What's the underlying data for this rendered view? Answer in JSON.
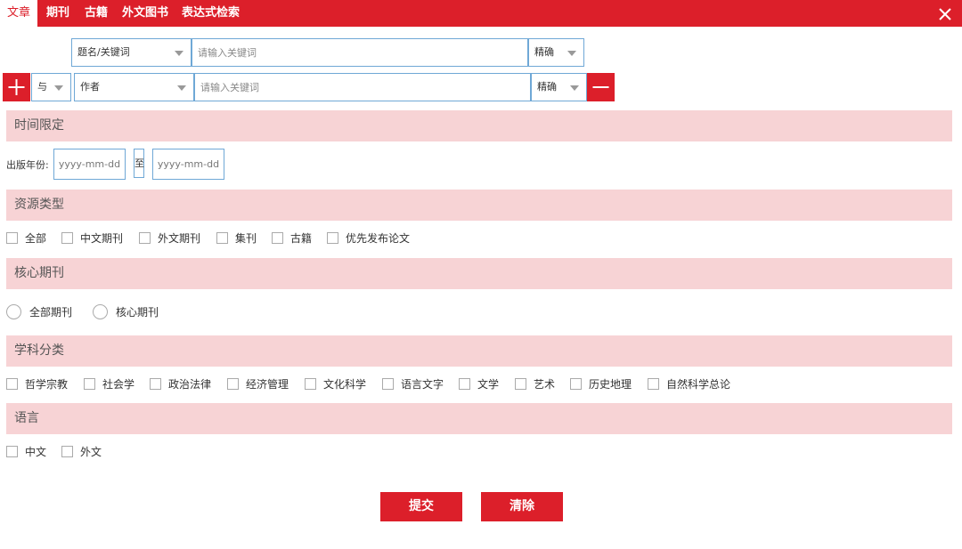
{
  "tabs": [
    {
      "label": "文章",
      "active": true
    },
    {
      "label": "期刊",
      "active": false
    },
    {
      "label": "古籍",
      "active": false
    },
    {
      "label": "外文图书",
      "active": false
    },
    {
      "label": "表达式检索",
      "active": false
    }
  ],
  "search": {
    "row1": {
      "field": "题名/关键词",
      "placeholder": "请输入关键词",
      "match": "精确"
    },
    "row2": {
      "logic": "与",
      "field": "作者",
      "placeholder": "请输入关键词",
      "match": "精确"
    }
  },
  "time_section": {
    "title": "时间限定",
    "label": "出版年份:",
    "from_placeholder": "yyyy-mm-dd",
    "to_text": "至",
    "to_placeholder": "yyyy-mm-dd"
  },
  "resource_section": {
    "title": "资源类型",
    "options": [
      "全部",
      "中文期刊",
      "外文期刊",
      "集刊",
      "古籍",
      "优先发布论文"
    ]
  },
  "core_section": {
    "title": "核心期刊",
    "options": [
      "全部期刊",
      "核心期刊"
    ]
  },
  "subject_section": {
    "title": "学科分类",
    "options": [
      "哲学宗教",
      "社会学",
      "政治法律",
      "经济管理",
      "文化科学",
      "语言文字",
      "文学",
      "艺术",
      "历史地理",
      "自然科学总论"
    ]
  },
  "language_section": {
    "title": "语言",
    "options": [
      "中文",
      "外文"
    ]
  },
  "buttons": {
    "submit": "提交",
    "clear": "清除"
  },
  "colors": {
    "accent": "#dc1f2a",
    "section_bg": "#f7d3d5",
    "input_border": "#6fa8d6"
  },
  "icons": [
    "close-icon",
    "plus-icon",
    "minus-icon",
    "chevron-down-icon"
  ]
}
